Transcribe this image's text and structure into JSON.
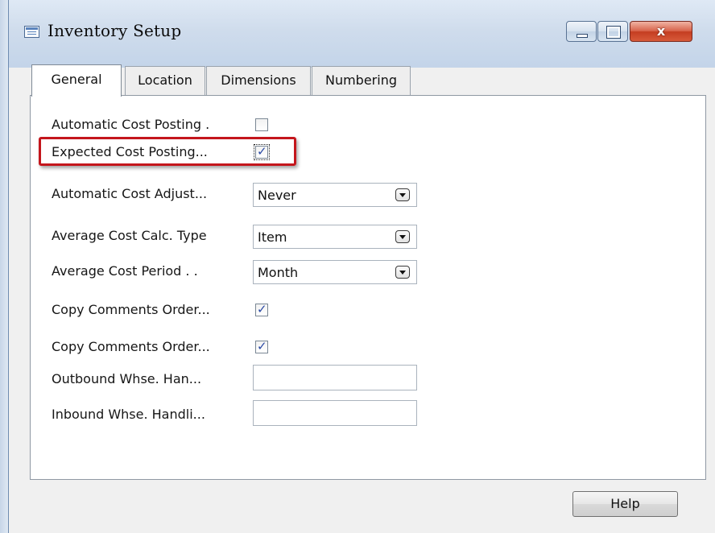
{
  "window": {
    "title": "Inventory Setup",
    "icon": "table-icon",
    "close_label": "x"
  },
  "tabs": [
    {
      "label": "General",
      "active": true
    },
    {
      "label": "Location",
      "active": false
    },
    {
      "label": "Dimensions",
      "active": false
    },
    {
      "label": "Numbering",
      "active": false
    }
  ],
  "fields": {
    "automatic_cost_posting": {
      "label": "Automatic Cost Posting  .",
      "checked": false
    },
    "expected_cost_posting": {
      "label": "Expected Cost Posting...",
      "checked": true
    },
    "automatic_cost_adjust": {
      "label": "Automatic Cost Adjust...",
      "value": "Never"
    },
    "average_cost_calc_type": {
      "label": "Average Cost Calc. Type",
      "value": "Item"
    },
    "average_cost_period": {
      "label": "Average Cost Period  .  .",
      "value": "Month"
    },
    "copy_comments_order_1": {
      "label": "Copy Comments Order...",
      "checked": true
    },
    "copy_comments_order_2": {
      "label": "Copy Comments Order...",
      "checked": true
    },
    "outbound_whse_han": {
      "label": "Outbound Whse. Han...",
      "value": ""
    },
    "inbound_whse_handli": {
      "label": "Inbound Whse. Handli...",
      "value": ""
    }
  },
  "buttons": {
    "help_label": "Help"
  },
  "colors": {
    "highlight": "#c4161c",
    "check": "#2b4aa5"
  }
}
